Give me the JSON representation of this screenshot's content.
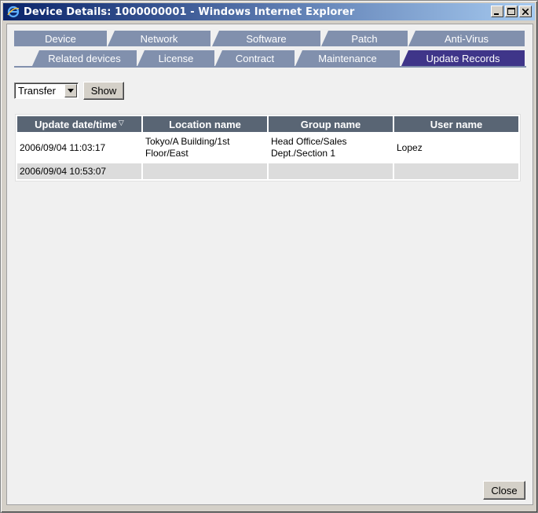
{
  "window": {
    "title": "Device Details: 1000000001 - Windows Internet Explorer",
    "buttons": {
      "minimize": "_",
      "maximize": "□",
      "close": "X"
    }
  },
  "tabs": {
    "row1": [
      "Device",
      "Network",
      "Software",
      "Patch",
      "Anti-Virus"
    ],
    "row2": [
      "Related devices",
      "License",
      "Contract",
      "Maintenance",
      "Update Records"
    ],
    "active": "Update Records"
  },
  "filter": {
    "selected": "Transfer",
    "show_label": "Show"
  },
  "table": {
    "headers": [
      "Update date/time",
      "Location name",
      "Group name",
      "User name"
    ],
    "sort_marker": "▽",
    "rows": [
      [
        "2006/09/04 11:03:17",
        "Tokyo/A Building/1st Floor/East",
        "Head Office/Sales Dept./Section 1",
        "Lopez"
      ],
      [
        "2006/09/04 10:53:07",
        "",
        "",
        ""
      ]
    ]
  },
  "footer": {
    "close_label": "Close"
  },
  "colors": {
    "tab": "#8190ad",
    "tab_active": "#3f3589",
    "table_header": "#596574",
    "title_bar": "#0a246a"
  },
  "icons": {
    "browser": "ie-logo-icon",
    "dropdown": "dropdown-arrow-icon"
  }
}
